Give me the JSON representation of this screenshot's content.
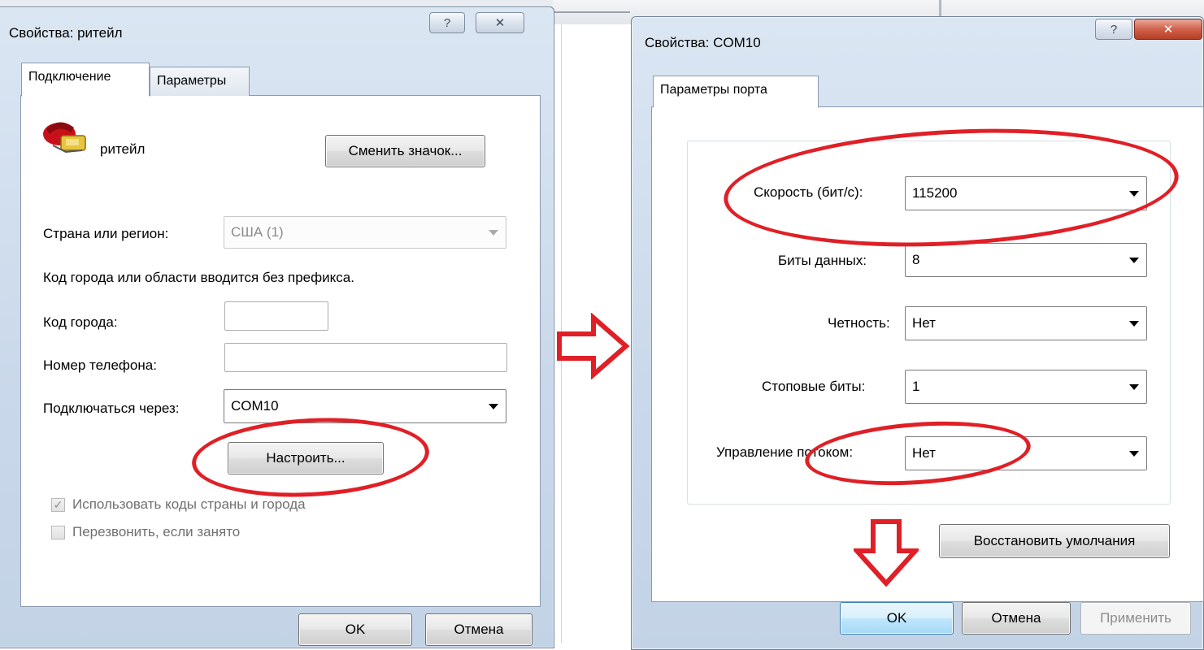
{
  "colors": {
    "annotation_red": "#e01f26",
    "dialog_frame": "#c9d8ea",
    "default_button": "#bee6fd"
  },
  "left_dialog": {
    "title": "Свойства: ритейл",
    "help_label": "?",
    "close_label": "✕",
    "tabs": [
      {
        "label": "Подключение",
        "active": true
      },
      {
        "label": "Параметры",
        "active": false
      }
    ],
    "connection_name": "ритейл",
    "connection_icon": "telephone-icon",
    "change_icon_button": "Сменить значок...",
    "country_label": "Страна или регион:",
    "country_value": "США (1)",
    "hint_text": "Код города или области вводится без префикса.",
    "area_code_label": "Код города:",
    "area_code_value": "",
    "phone_label": "Номер телефона:",
    "phone_value": "",
    "connect_via_label": "Подключаться через:",
    "connect_via_value": "COM10",
    "configure_button": "Настроить...",
    "use_country_code_label": "Использовать коды страны и города",
    "use_country_code_checked": true,
    "redial_label": "Перезвонить, если занято",
    "redial_checked": false,
    "ok_button": "OK",
    "cancel_button": "Отмена"
  },
  "right_dialog": {
    "title": "Свойства: COM10",
    "help_label": "?",
    "close_label": "✕",
    "tabs": [
      {
        "label": "Параметры порта",
        "active": true
      }
    ],
    "speed_label": "Скорость (бит/с):",
    "speed_value": "115200",
    "data_bits_label": "Биты данных:",
    "data_bits_value": "8",
    "parity_label": "Четность:",
    "parity_value": "Нет",
    "stop_bits_label": "Стоповые биты:",
    "stop_bits_value": "1",
    "flow_control_label": "Управление потоком:",
    "flow_control_value": "Нет",
    "restore_defaults_button": "Восстановить умолчания",
    "ok_button": "OK",
    "cancel_button": "Отмена",
    "apply_button": "Применить"
  }
}
